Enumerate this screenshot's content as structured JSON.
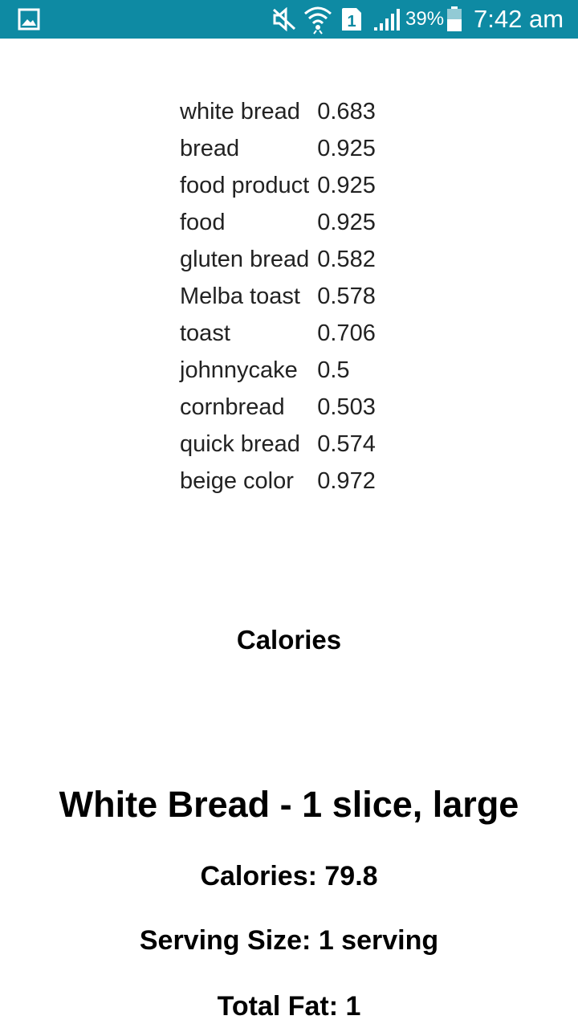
{
  "status_bar": {
    "battery_percent": "39%",
    "time": "7:42 am",
    "sim_slot": "1",
    "icons": [
      "gallery-icon",
      "mute-icon",
      "wifi-icon",
      "sim-icon",
      "signal-icon",
      "battery-icon"
    ],
    "background_color": "#0e8aa3"
  },
  "labels": [
    {
      "name": "white bread",
      "score": "0.683"
    },
    {
      "name": "bread",
      "score": "0.925"
    },
    {
      "name": "food product",
      "score": "0.925"
    },
    {
      "name": "food",
      "score": "0.925"
    },
    {
      "name": "gluten bread",
      "score": "0.582"
    },
    {
      "name": "Melba toast",
      "score": "0.578"
    },
    {
      "name": "toast",
      "score": "0.706"
    },
    {
      "name": "johnnycake",
      "score": "0.5"
    },
    {
      "name": "cornbread",
      "score": "0.503"
    },
    {
      "name": "quick bread",
      "score": "0.574"
    },
    {
      "name": "beige color",
      "score": "0.972"
    }
  ],
  "calories_section": {
    "heading": "Calories",
    "food_title": "White Bread - 1 slice, large",
    "calories": "Calories: 79.8",
    "serving_size": "Serving Size: 1 serving",
    "total_fat": "Total Fat: 1"
  }
}
